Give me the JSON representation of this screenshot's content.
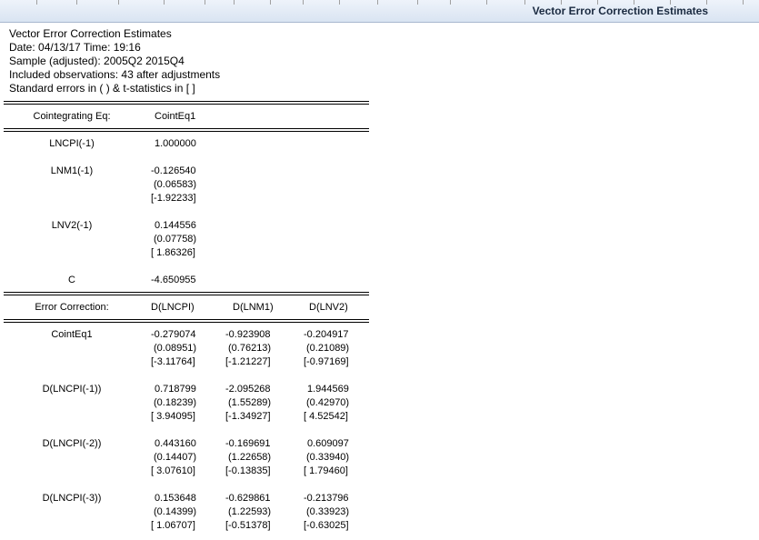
{
  "window": {
    "title": "Vector Error Correction Estimates"
  },
  "header_lines": [
    "Vector Error Correction Estimates",
    "Date: 04/13/17   Time: 19:16",
    "Sample (adjusted): 2005Q2 2015Q4",
    "Included observations: 43 after adjustments",
    "Standard errors in ( ) & t-statistics in [ ]"
  ],
  "coint": {
    "header_label": "Cointegrating Eq:",
    "header_col": "CointEq1",
    "rows": [
      {
        "label": "LNCPI(-1)",
        "coef": "1.000000"
      },
      {
        "label": "LNM1(-1)",
        "coef": "-0.126540",
        "se": "(0.06583)",
        "t": "[-1.92233]"
      },
      {
        "label": "LNV2(-1)",
        "coef": "0.144556",
        "se": "(0.07758)",
        "t": "[ 1.86326]"
      },
      {
        "label": "C",
        "coef": "-4.650955"
      }
    ]
  },
  "ec": {
    "header_label": "Error Correction:",
    "columns": [
      "D(LNCPI)",
      "D(LNM1)",
      "D(LNV2)"
    ],
    "rows": [
      {
        "label": "CointEq1",
        "cells": [
          [
            "-0.279074",
            "(0.08951)",
            "[-3.11764]"
          ],
          [
            "-0.923908",
            "(0.76213)",
            "[-1.21227]"
          ],
          [
            "-0.204917",
            "(0.21089)",
            "[-0.97169]"
          ]
        ]
      },
      {
        "label": "D(LNCPI(-1))",
        "cells": [
          [
            "0.718799",
            "(0.18239)",
            "[ 3.94095]"
          ],
          [
            "-2.095268",
            "(1.55289)",
            "[-1.34927]"
          ],
          [
            "1.944569",
            "(0.42970)",
            "[ 4.52542]"
          ]
        ]
      },
      {
        "label": "D(LNCPI(-2))",
        "cells": [
          [
            "0.443160",
            "(0.14407)",
            "[ 3.07610]"
          ],
          [
            "-0.169691",
            "(1.22658)",
            "[-0.13835]"
          ],
          [
            "0.609097",
            "(0.33940)",
            "[ 1.79460]"
          ]
        ]
      },
      {
        "label": "D(LNCPI(-3))",
        "cells": [
          [
            "0.153648",
            "(0.14399)",
            "[ 1.06707]"
          ],
          [
            "-0.629861",
            "(1.22593)",
            "[-0.51378]"
          ],
          [
            "-0.213796",
            "(0.33923)",
            "[-0.63025]"
          ]
        ]
      }
    ]
  }
}
